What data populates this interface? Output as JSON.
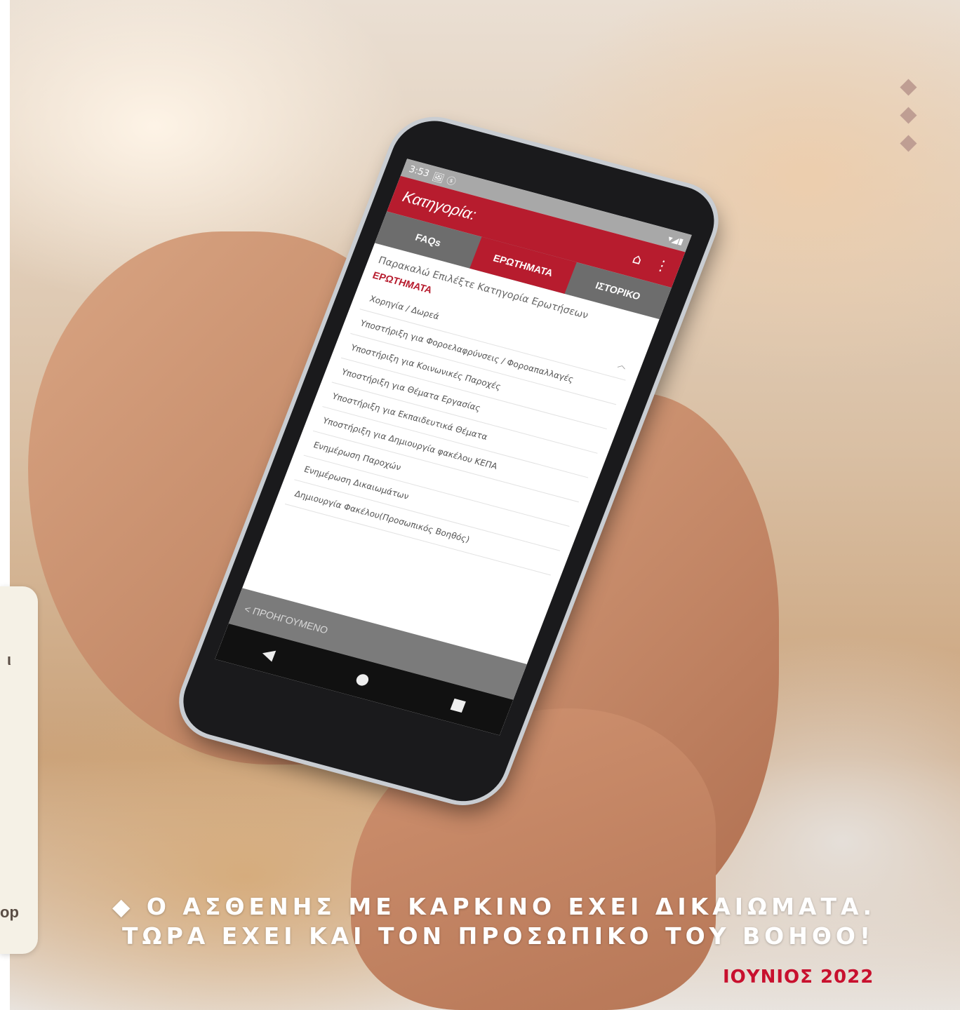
{
  "phone": {
    "status": {
      "time": "3:53",
      "icons": "🖼 ⓢ",
      "signal": "▾◢▮"
    },
    "appbar": {
      "title": "Κατηγορία:",
      "home_icon": "home-icon",
      "more_icon": "more-icon"
    },
    "tabs": [
      {
        "label": "FAQs"
      },
      {
        "label": "ΕΡΩΤΗΜΑΤΑ"
      },
      {
        "label": "ΙΣΤΟΡΙΚΟ"
      }
    ],
    "prompt": "Παρακαλώ Επιλέξτε Κατηγορία Ερωτήσεων",
    "section_title": "ΕΡΩΤΗΜΑΤΑ",
    "items": [
      {
        "label": "Χορηγία / Δωρεά"
      },
      {
        "label": "Υποστήριξη για Φοροελαφρύνσεις / Φοροαπαλλαγές"
      },
      {
        "label": "Υποστήριξη για Κοινωνικές Παροχές"
      },
      {
        "label": "Υποστήριξη για Θέματα Εργασίας"
      },
      {
        "label": "Υποστήριξη για Εκπαιδευτικά Θέματα"
      },
      {
        "label": "Υποστήριξη για Δημιουργία φακέλου ΚΕΠΑ"
      },
      {
        "label": "Ενημέρωση Παροχών"
      },
      {
        "label": "Ενημέρωση Δικαιωμάτων"
      },
      {
        "label": "Δημιουργία Φακέλου(Προσωπικός Βοηθός)"
      }
    ],
    "prev_button": "< ΠΡΟΗΓΟΥΜΕΝΟ",
    "nav": {
      "back": "◀",
      "home": "●",
      "recent": "■"
    }
  },
  "tagline": {
    "line1": "◆ Ο ΑΣΘΕΝΗΣ ΜΕ ΚΑΡΚΙΝΟ ΕΧΕΙ ΔΙΚΑΙΩΜΑΤΑ.",
    "line2": "ΤΩΡΑ ΕΧΕΙ ΚΑΙ ΤΟΝ ΠΡΟΣΩΠΙΚΟ ΤΟΥ ΒΟΗΘΟ!"
  },
  "date": "ΙΟΥΝΙΟΣ 2022",
  "side_card": {
    "glyph_top": "ι",
    "glyph_bottom": "op"
  },
  "colors": {
    "brand_red": "#b71c2e",
    "accent_diamond": "#bf9e93",
    "date_red": "#c8102e"
  }
}
